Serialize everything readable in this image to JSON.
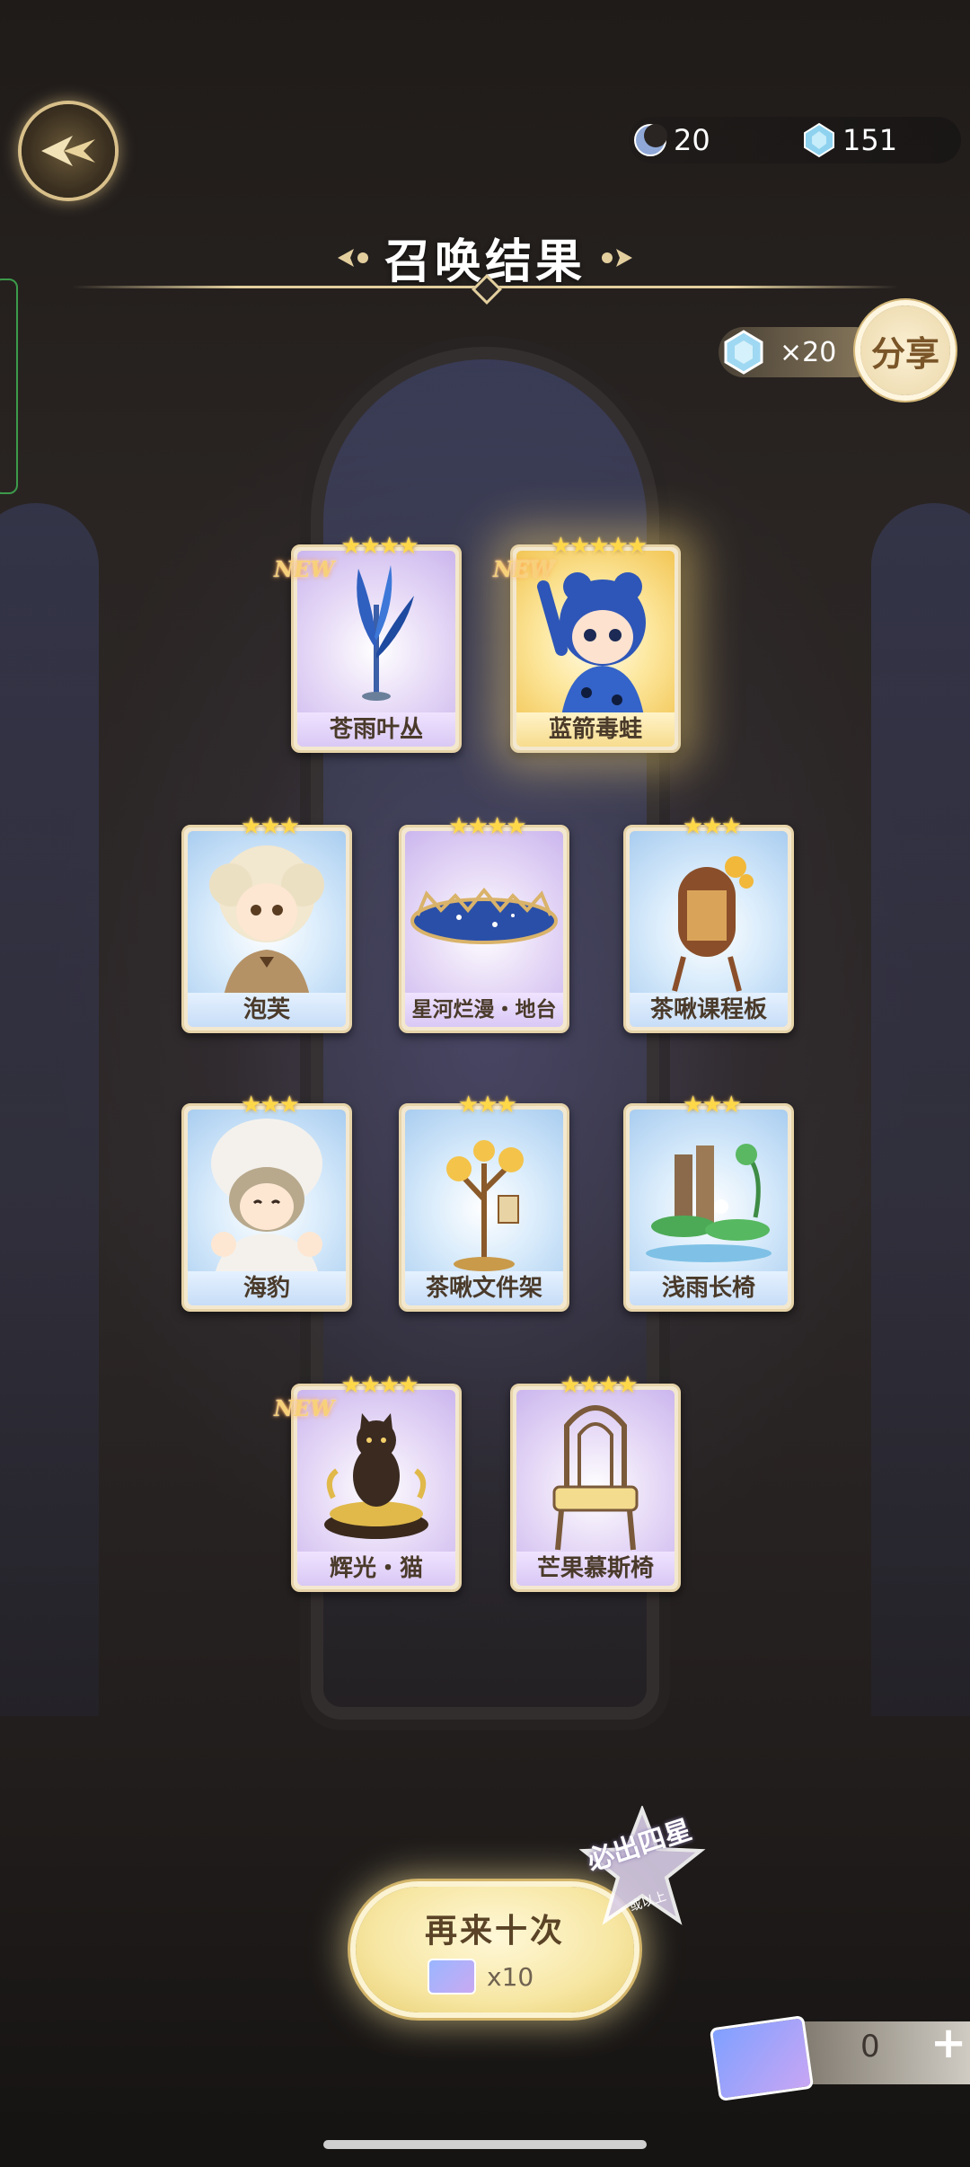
{
  "header": {
    "moon_currency": "20",
    "crystal_currency": "151",
    "title": "召唤结果"
  },
  "share": {
    "reward": "×20",
    "label": "分享"
  },
  "cards": [
    {
      "name": "苍雨叶丛",
      "stars": "★★★★",
      "new": "NEW",
      "rarity": "purple"
    },
    {
      "name": "蓝箭毒蛙",
      "stars": "★★★★★",
      "new": "NEW",
      "rarity": "gold"
    },
    {
      "name": "泡芙",
      "stars": "★★★",
      "new": "",
      "rarity": "blue"
    },
    {
      "name": "星河烂漫・地台",
      "stars": "★★★★",
      "new": "",
      "rarity": "purple"
    },
    {
      "name": "茶啾课程板",
      "stars": "★★★",
      "new": "",
      "rarity": "blue"
    },
    {
      "name": "海豹",
      "stars": "★★★",
      "new": "",
      "rarity": "blue"
    },
    {
      "name": "茶啾文件架",
      "stars": "★★★",
      "new": "",
      "rarity": "blue"
    },
    {
      "name": "浅雨长椅",
      "stars": "★★★",
      "new": "",
      "rarity": "blue"
    },
    {
      "name": "辉光・猫",
      "stars": "★★★★",
      "new": "NEW",
      "rarity": "purple"
    },
    {
      "name": "芒果慕斯椅",
      "stars": "★★★★",
      "new": "",
      "rarity": "purple"
    }
  ],
  "summon_again": {
    "label": "再来十次",
    "cost": "x10"
  },
  "guarantee": {
    "text": "必出四星",
    "sub": "或以上"
  },
  "tickets": {
    "count": "0",
    "plus": "+"
  }
}
